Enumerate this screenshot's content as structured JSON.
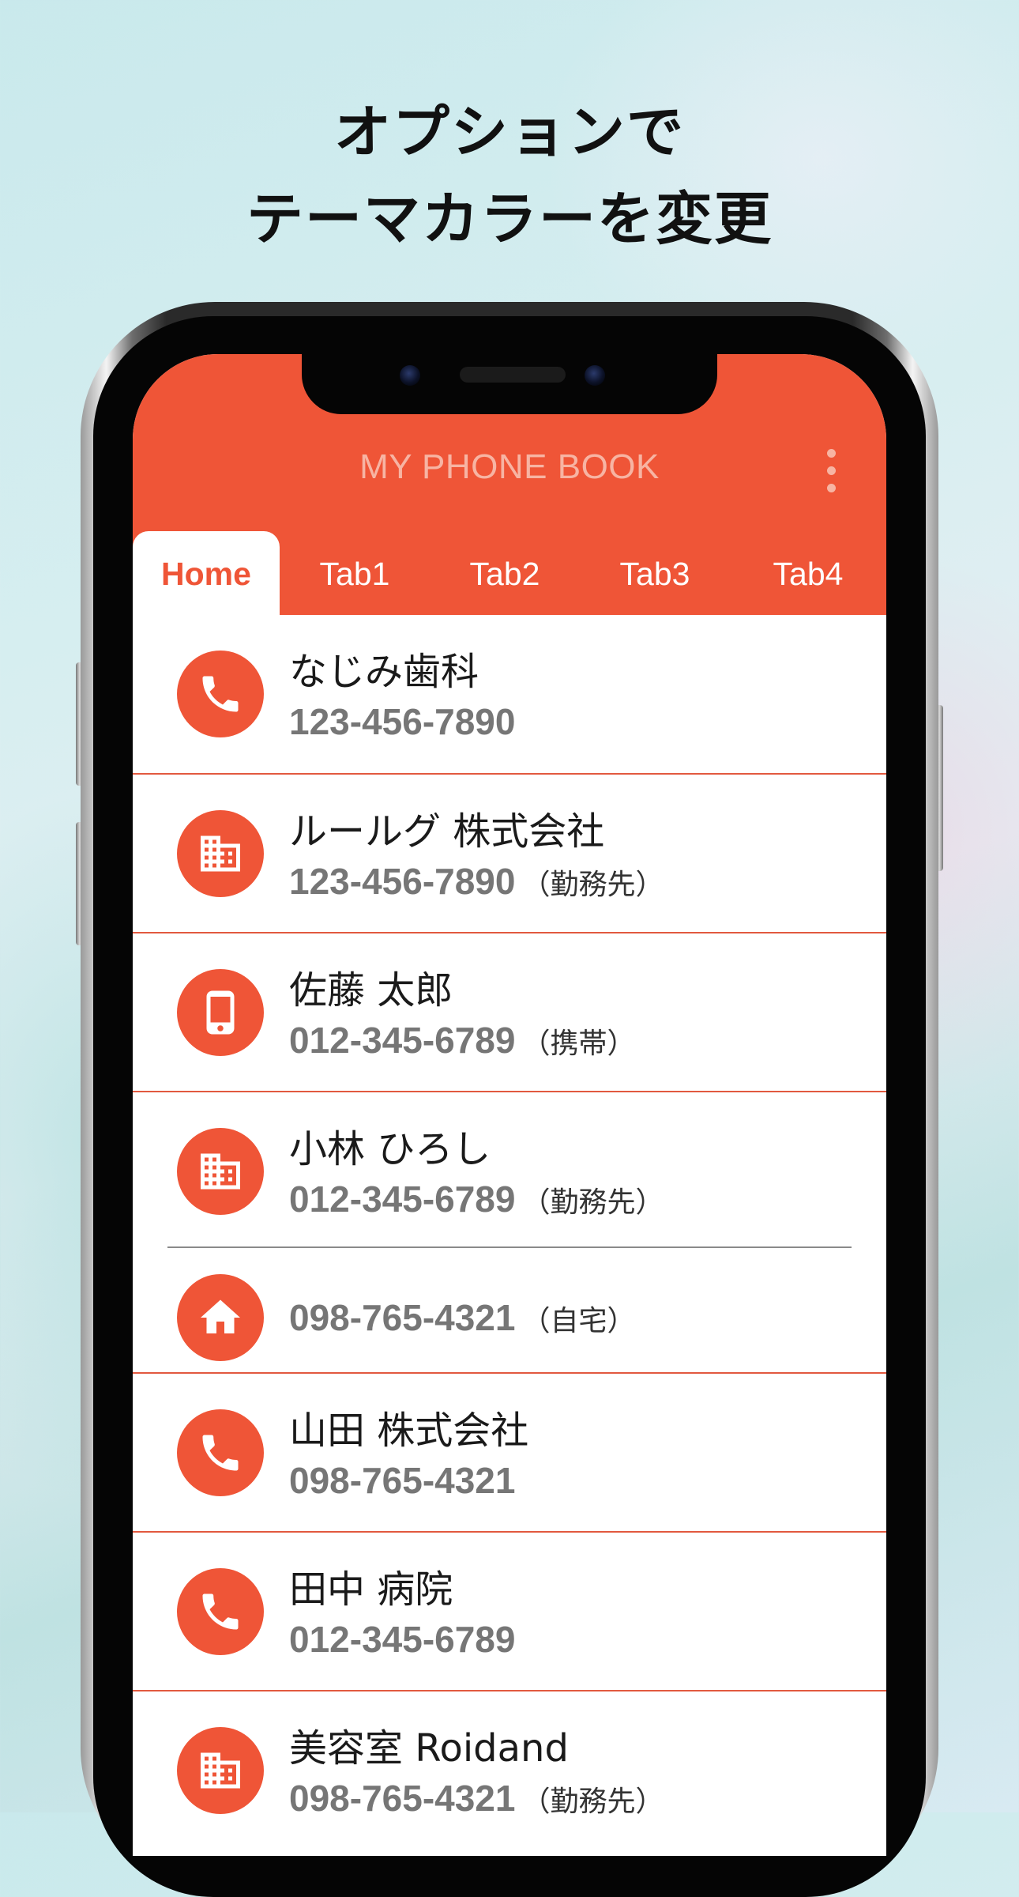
{
  "headline": {
    "line1": "オプションで",
    "line2": "テーマカラーを変更"
  },
  "colors": {
    "accent": "#ef5537",
    "title_text": "#f7b4a3",
    "number_text": "#767676"
  },
  "appbar": {
    "title": "MY PHONE BOOK",
    "menu_icon": "more-vert-icon"
  },
  "tabs": [
    {
      "label": "Home",
      "active": true
    },
    {
      "label": "Tab1",
      "active": false
    },
    {
      "label": "Tab2",
      "active": false
    },
    {
      "label": "Tab3",
      "active": false
    },
    {
      "label": "Tab4",
      "active": false
    }
  ],
  "contacts": [
    {
      "name": "なじみ歯科",
      "number": "123-456-7890",
      "label": "",
      "icon": "phone-icon"
    },
    {
      "name": "ルールグ 株式会社",
      "number": "123-456-7890",
      "label": "（勤務先）",
      "icon": "business-icon"
    },
    {
      "name": "佐藤 太郎",
      "number": "012-345-6789",
      "label": "（携帯）",
      "icon": "mobile-icon"
    },
    {
      "name": "小林 ひろし",
      "number": "012-345-6789",
      "label": "（勤務先）",
      "icon": "business-icon"
    },
    {
      "name": "",
      "number": "098-765-4321",
      "label": "（自宅）",
      "icon": "home-icon"
    },
    {
      "name": "山田 株式会社",
      "number": "098-765-4321",
      "label": "",
      "icon": "phone-icon"
    },
    {
      "name": "田中 病院",
      "number": "012-345-6789",
      "label": "",
      "icon": "phone-icon"
    },
    {
      "name": "美容室 Roidand",
      "number": "098-765-4321",
      "label": "（勤務先）",
      "icon": "business-icon"
    }
  ]
}
